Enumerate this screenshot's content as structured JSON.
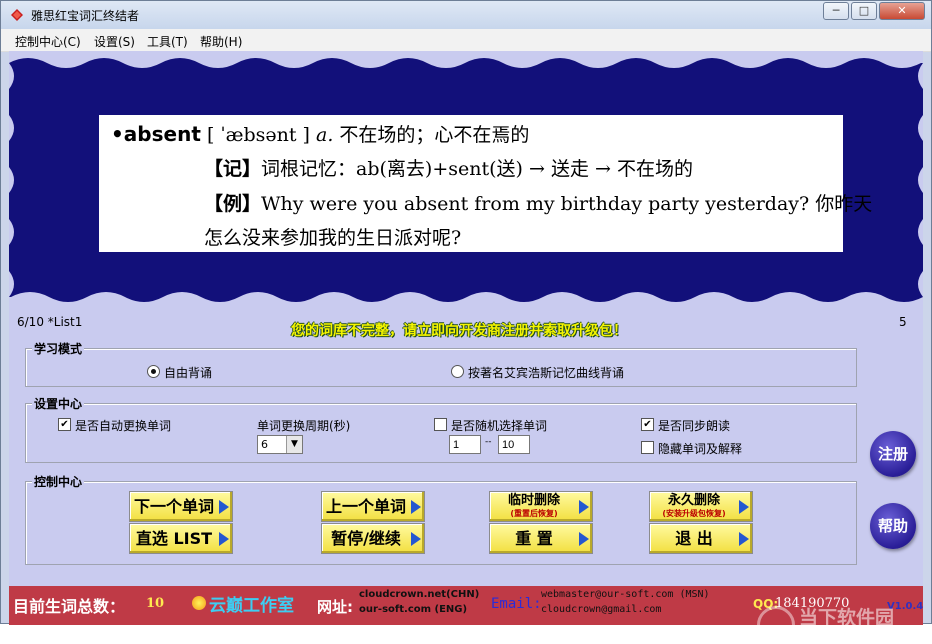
{
  "window": {
    "title": "雅思红宝词汇终结者",
    "minimize_glyph": "─",
    "maximize_glyph": "□",
    "close_glyph": "✕"
  },
  "menu": [
    "控制中心(C)",
    "设置(S)",
    "工具(T)",
    "帮助(H)"
  ],
  "word_card": {
    "headword": "absent",
    "phonetic": "[ ˈæbsənt ]",
    "pos": "a.",
    "meaning": "不在场的；心不在焉的",
    "memory_tag": "【记】",
    "memory_text": "词根记忆：ab(离去)+sent(送) → 送走 → 不在场的",
    "example_tag": "【例】",
    "example_text": "Why were you absent from my birthday party yesterday? 你昨天",
    "example_text_2": "怎么没来参加我的生日派对呢?"
  },
  "status": {
    "progress": "6/10 *List1",
    "right_number": "5",
    "warning": "您的词库不完整，请立即向开发商注册并索取升级包！"
  },
  "study_mode": {
    "legend": "学习模式",
    "option_free": "自由背诵",
    "option_curve": "按著名艾宾浩斯记忆曲线背诵",
    "selected": "free"
  },
  "settings": {
    "legend": "设置中心",
    "auto_change": {
      "label": "是否自动更换单词",
      "checked": true
    },
    "period_label": "单词更换周期(秒)",
    "period_value": "6",
    "random_select": {
      "label": "是否随机选择单词",
      "checked": false
    },
    "range_from": "1",
    "range_sep": "--",
    "range_to": "10",
    "sync_read": {
      "label": "是否同步朗读",
      "checked": true
    },
    "hide_words": {
      "label": "隐藏单词及解释",
      "checked": false
    }
  },
  "control": {
    "legend": "控制中心",
    "next": "下一个单词",
    "prev": "上一个单词",
    "temp_delete": "临时删除",
    "temp_delete_sub": "(重置后恢复)",
    "perm_delete": "永久删除",
    "perm_delete_sub": "(安装升级包恢复)",
    "pick_list": "直选 LIST",
    "pause_resume": "暂停/继续",
    "reset": "重  置",
    "exit": "退  出"
  },
  "side_buttons": {
    "register": "注册",
    "help": "帮助"
  },
  "footer": {
    "count_label": "目前生词总数：",
    "count_value": "10",
    "studio": "云巅工作室",
    "web_label": "网址:",
    "web_1": "cloudcrown.net(CHN)",
    "web_2": "our-soft.com (ENG)",
    "email_label": "Email:",
    "email_1": "webmaster@our-soft.com (MSN)",
    "email_2": "cloudcrown@gmail.com",
    "qq_label": "QQ:",
    "qq_value": "184190770",
    "version": "V1.0.4"
  },
  "watermark": "当下软件园",
  "colors": {
    "banner_navy": "#12107a",
    "client_bg": "#c9cbef",
    "footer_red": "#bf3a46",
    "button_yellow": "#f5e24a",
    "arrow_blue": "#2457d0",
    "warning_yellow": "#f4f400"
  }
}
